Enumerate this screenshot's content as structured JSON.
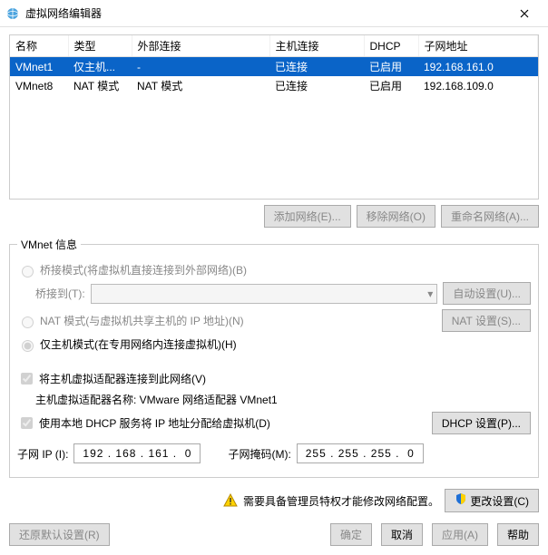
{
  "window": {
    "title": "虚拟网络编辑器"
  },
  "table": {
    "headers": {
      "name": "名称",
      "type": "类型",
      "ext": "外部连接",
      "hostconn": "主机连接",
      "dhcp": "DHCP",
      "subnet": "子网地址"
    },
    "rows": [
      {
        "name": "VMnet1",
        "type": "仅主机...",
        "ext": "-",
        "hostconn": "已连接",
        "dhcp": "已启用",
        "subnet": "192.168.161.0",
        "selected": true
      },
      {
        "name": "VMnet8",
        "type": "NAT 模式",
        "ext": "NAT 模式",
        "hostconn": "已连接",
        "dhcp": "已启用",
        "subnet": "192.168.109.0",
        "selected": false
      }
    ]
  },
  "buttons": {
    "add_net": "添加网络(E)...",
    "remove_net": "移除网络(O)",
    "rename_net": "重命名网络(A)...",
    "auto_set": "自动设置(U)...",
    "nat_set": "NAT 设置(S)...",
    "dhcp_set": "DHCP 设置(P)...",
    "change_set": "更改设置(C)",
    "restore": "还原默认设置(R)",
    "ok": "确定",
    "cancel": "取消",
    "apply": "应用(A)",
    "help": "帮助"
  },
  "group": {
    "title": "VMnet 信息",
    "bridge": "桥接模式(将虚拟机直接连接到外部网络)(B)",
    "bridge_to": "桥接到(T):",
    "nat": "NAT 模式(与虚拟机共享主机的 IP 地址)(N)",
    "hostonly": "仅主机模式(在专用网络内连接虚拟机)(H)",
    "connect_adapter": "将主机虚拟适配器连接到此网络(V)",
    "adapter_name": "主机虚拟适配器名称: VMware 网络适配器 VMnet1",
    "use_dhcp": "使用本地 DHCP 服务将 IP 地址分配给虚拟机(D)",
    "subnet_ip_label": "子网 IP (I):",
    "subnet_ip": "192 . 168 . 161 .  0",
    "subnet_mask_label": "子网掩码(M):",
    "subnet_mask": "255 . 255 . 255 .  0"
  },
  "alert": "需要具备管理员特权才能修改网络配置。"
}
